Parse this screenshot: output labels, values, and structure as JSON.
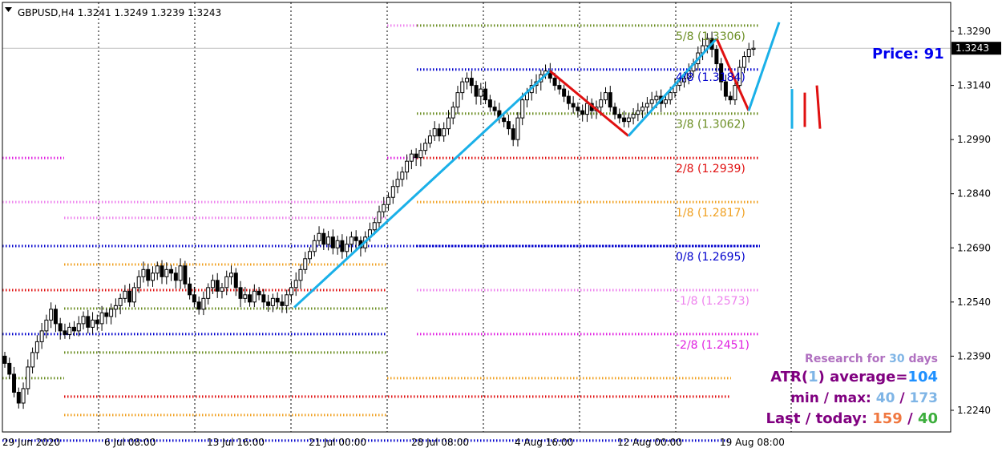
{
  "header": {
    "symbol_line": "GBPUSD,H4  1.3241 1.3249 1.3239 1.3243",
    "menu_icon": "triangle-down-icon"
  },
  "colors": {
    "background": "#ffffff",
    "frame": "#000000",
    "bull_body": "#ffffff",
    "bear_body": "#000000",
    "price_label_bg": "#000000",
    "price_label_text": "#ffffff",
    "price_text": "#0000ee",
    "zigzag_up": "#1ab0e8",
    "zigzag_down": "#e01010",
    "research_color": "#b070c0",
    "atr_color": "#800080",
    "atr_value_color": "#1e90ff",
    "minmax_color": "#7fb5e6",
    "last_color": "#f07840",
    "today_color": "#3cae3c"
  },
  "price_label": "1.3243",
  "price_readout": "Price: 91",
  "chart_data": {
    "type": "candlestick",
    "title": "GBPUSD,H4",
    "ohlc_current": {
      "open": 1.3241,
      "high": 1.3249,
      "low": 1.3239,
      "close": 1.3243
    },
    "ylim": [
      1.218,
      1.337
    ],
    "y_ticks": [
      "1.3290",
      "1.3140",
      "1.2990",
      "1.2840",
      "1.2690",
      "1.2540",
      "1.2390",
      "1.2240"
    ],
    "x_ticks": [
      "29 Jun 2020",
      "6 Jul 08:00",
      "13 Jul 16:00",
      "21 Jul 00:00",
      "28 Jul 08:00",
      "4 Aug 16:00",
      "12 Aug 00:00",
      "19 Aug 08:00"
    ],
    "grid": true,
    "murrey_levels": [
      {
        "label": "5/8 (1.3306)",
        "value": 1.3306,
        "color": "#6b8e23"
      },
      {
        "label": "4/8 (1.3184)",
        "value": 1.3184,
        "color": "#0000cd"
      },
      {
        "label": "3/8 (1.3062)",
        "value": 1.3062,
        "color": "#6b8e23"
      },
      {
        "label": "2/8 (1.2939)",
        "value": 1.2939,
        "color": "#e01010"
      },
      {
        "label": "1/8 (1.2817)",
        "value": 1.2817,
        "color": "#f0a020"
      },
      {
        "label": "0/8 (1.2695)",
        "value": 1.2695,
        "color": "#0000cd"
      },
      {
        "label": "-1/8 (1.2573)",
        "value": 1.2573,
        "color": "#ee82ee"
      },
      {
        "label": "-2/8 (1.2451)",
        "value": 1.2451,
        "color": "#e020e0"
      }
    ],
    "close_series": [
      1.237,
      1.234,
      1.229,
      1.226,
      1.23,
      1.236,
      1.24,
      1.243,
      1.246,
      1.249,
      1.252,
      1.248,
      1.246,
      1.245,
      1.247,
      1.246,
      1.248,
      1.25,
      1.247,
      1.249,
      1.248,
      1.251,
      1.25,
      1.252,
      1.253,
      1.255,
      1.257,
      1.254,
      1.258,
      1.261,
      1.263,
      1.26,
      1.262,
      1.264,
      1.261,
      1.263,
      1.262,
      1.26,
      1.264,
      1.259,
      1.256,
      1.254,
      1.252,
      1.255,
      1.258,
      1.26,
      1.257,
      1.258,
      1.261,
      1.262,
      1.258,
      1.255,
      1.256,
      1.254,
      1.257,
      1.256,
      1.254,
      1.253,
      1.255,
      1.254,
      1.253,
      1.256,
      1.258,
      1.26,
      1.263,
      1.266,
      1.268,
      1.271,
      1.273,
      1.27,
      1.272,
      1.269,
      1.271,
      1.268,
      1.27,
      1.272,
      1.271,
      1.269,
      1.272,
      1.274,
      1.276,
      1.279,
      1.281,
      1.283,
      1.286,
      1.288,
      1.29,
      1.293,
      1.295,
      1.294,
      1.296,
      1.298,
      1.3,
      1.302,
      1.3,
      1.302,
      1.305,
      1.308,
      1.312,
      1.315,
      1.316,
      1.314,
      1.311,
      1.313,
      1.31,
      1.308,
      1.307,
      1.305,
      1.304,
      1.302,
      1.299,
      1.305,
      1.31,
      1.312,
      1.314,
      1.315,
      1.317,
      1.318,
      1.316,
      1.314,
      1.313,
      1.311,
      1.309,
      1.308,
      1.307,
      1.306,
      1.309,
      1.307,
      1.308,
      1.31,
      1.312,
      1.308,
      1.306,
      1.305,
      1.304,
      1.305,
      1.306,
      1.307,
      1.308,
      1.309,
      1.31,
      1.311,
      1.309,
      1.31,
      1.312,
      1.314,
      1.315,
      1.316,
      1.318,
      1.32,
      1.323,
      1.325,
      1.327,
      1.324,
      1.32,
      1.315,
      1.311,
      1.31,
      1.314,
      1.319,
      1.322,
      1.324,
      1.3243
    ]
  },
  "stats": {
    "research_prefix": "Research for ",
    "research_days": "30",
    "research_suffix": " days",
    "atr_prefix": "ATR(",
    "atr_period": "1",
    "atr_mid": ") average=",
    "atr_value": "104",
    "minmax_prefix": "min / max: ",
    "min_value": "40",
    "minmax_sep": " / ",
    "max_value": "173",
    "last_prefix": "Last / today: ",
    "last_value": "159",
    "last_sep": " / ",
    "today_value": "40"
  }
}
